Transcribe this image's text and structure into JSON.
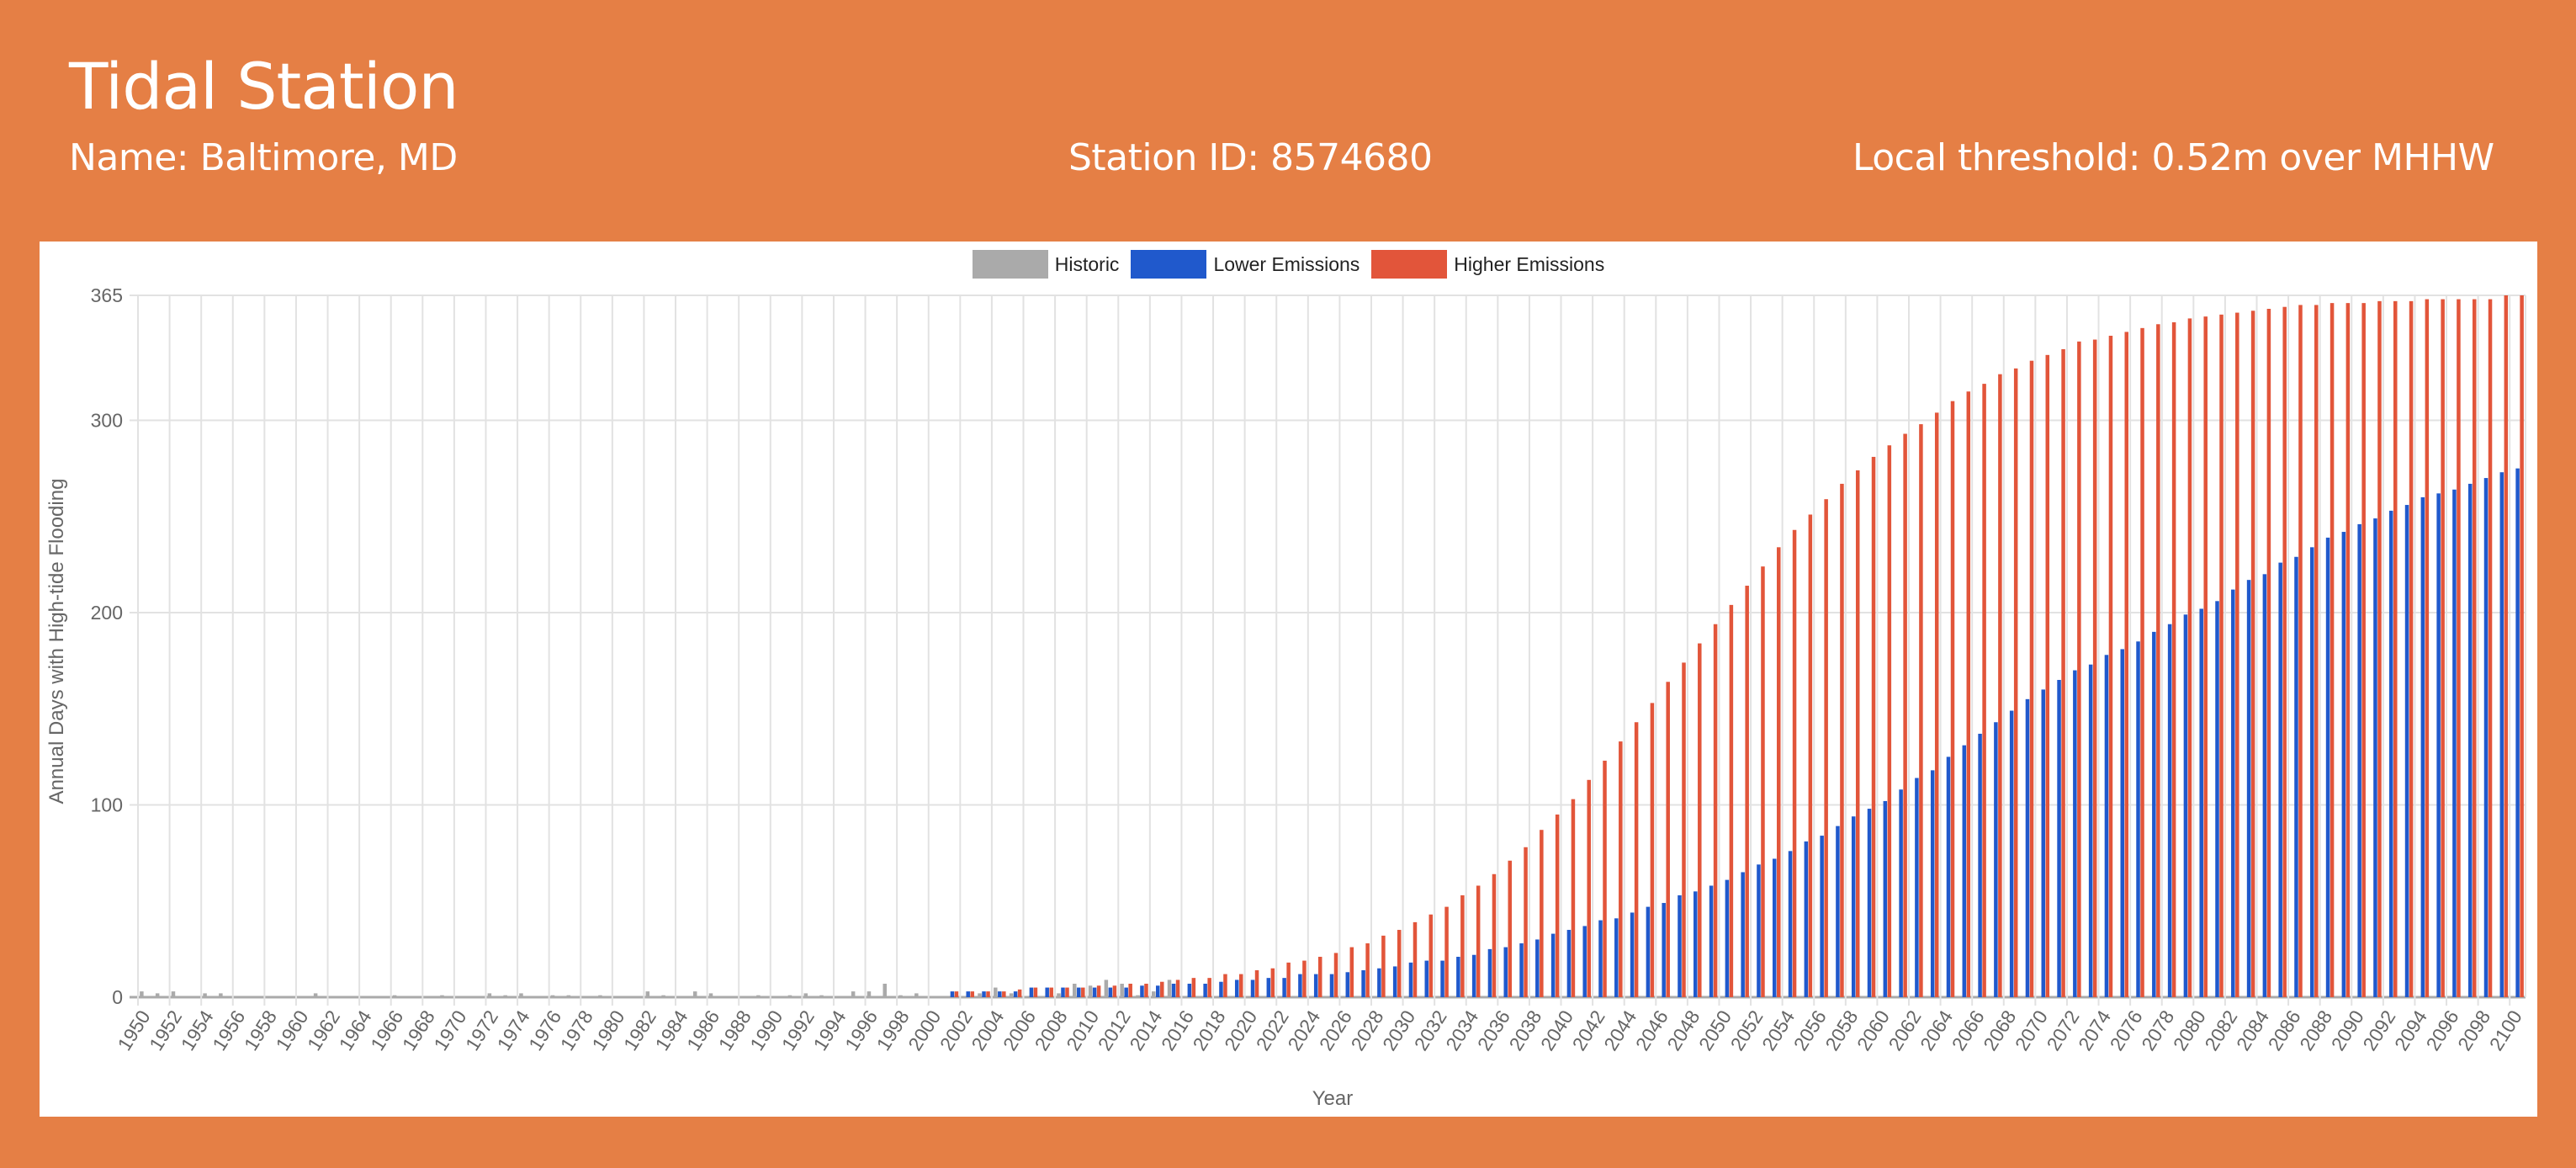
{
  "header": {
    "title": "Tidal Station",
    "name": "Name: Baltimore, MD",
    "station_id": "Station ID: 8574680",
    "threshold": "Local threshold: 0.52m over MHHW"
  },
  "colors": {
    "background": "#E57F45",
    "historic": "#AAAAAA",
    "lower": "#2059CC",
    "higher": "#E2553A"
  },
  "chart_data": {
    "type": "bar",
    "title": "",
    "xlabel": "Year",
    "ylabel": "Annual Days with High-tide Flooding",
    "ylim": [
      0,
      365
    ],
    "yticks": [
      0,
      100,
      200,
      300,
      365
    ],
    "grid": true,
    "legend_position": "top",
    "categories": [
      1950,
      1951,
      1952,
      1953,
      1954,
      1955,
      1956,
      1957,
      1958,
      1959,
      1960,
      1961,
      1962,
      1963,
      1964,
      1965,
      1966,
      1967,
      1968,
      1969,
      1970,
      1971,
      1972,
      1973,
      1974,
      1975,
      1976,
      1977,
      1978,
      1979,
      1980,
      1981,
      1982,
      1983,
      1984,
      1985,
      1986,
      1987,
      1988,
      1989,
      1990,
      1991,
      1992,
      1993,
      1994,
      1995,
      1996,
      1997,
      1998,
      1999,
      2000,
      2001,
      2002,
      2003,
      2004,
      2005,
      2006,
      2007,
      2008,
      2009,
      2010,
      2011,
      2012,
      2013,
      2014,
      2015,
      2016,
      2017,
      2018,
      2019,
      2020,
      2021,
      2022,
      2023,
      2024,
      2025,
      2026,
      2027,
      2028,
      2029,
      2030,
      2031,
      2032,
      2033,
      2034,
      2035,
      2036,
      2037,
      2038,
      2039,
      2040,
      2041,
      2042,
      2043,
      2044,
      2045,
      2046,
      2047,
      2048,
      2049,
      2050,
      2051,
      2052,
      2053,
      2054,
      2055,
      2056,
      2057,
      2058,
      2059,
      2060,
      2061,
      2062,
      2063,
      2064,
      2065,
      2066,
      2067,
      2068,
      2069,
      2070,
      2071,
      2072,
      2073,
      2074,
      2075,
      2076,
      2077,
      2078,
      2079,
      2080,
      2081,
      2082,
      2083,
      2084,
      2085,
      2086,
      2087,
      2088,
      2089,
      2090,
      2091,
      2092,
      2093,
      2094,
      2095,
      2096,
      2097,
      2098,
      2099,
      2100
    ],
    "series": [
      {
        "name": "Historic",
        "color": "#AAAAAA",
        "values": [
          3,
          2,
          3,
          0,
          2,
          2,
          0,
          0,
          0,
          0,
          0,
          2,
          0,
          0,
          0,
          0,
          1,
          0,
          0,
          1,
          0,
          0,
          2,
          1,
          2,
          0,
          1,
          1,
          0,
          1,
          0,
          0,
          3,
          1,
          0,
          3,
          2,
          0,
          0,
          1,
          0,
          1,
          2,
          1,
          0,
          3,
          3,
          7,
          1,
          2,
          0,
          0,
          0,
          2,
          5,
          2,
          0,
          0,
          2,
          7,
          6,
          9,
          7,
          1,
          3,
          9,
          null,
          null,
          null,
          null,
          null,
          null,
          null,
          null,
          null,
          null,
          null,
          null,
          null,
          null,
          null,
          null,
          null,
          null,
          null,
          null,
          null,
          null,
          null,
          null,
          null,
          null,
          null,
          null,
          null,
          null,
          null,
          null,
          null,
          null,
          null,
          null,
          null,
          null,
          null,
          null,
          null,
          null,
          null,
          null,
          null,
          null,
          null,
          null,
          null,
          null,
          null,
          null,
          null,
          null,
          null,
          null,
          null,
          null,
          null,
          null,
          null,
          null,
          null,
          null,
          null,
          null,
          null,
          null,
          null,
          null,
          null,
          null,
          null,
          null,
          null,
          null,
          null,
          null,
          null,
          null,
          null,
          null,
          null,
          null,
          null
        ]
      },
      {
        "name": "Lower Emissions",
        "color": "#2059CC",
        "values": [
          null,
          null,
          null,
          null,
          null,
          null,
          null,
          null,
          null,
          null,
          null,
          null,
          null,
          null,
          null,
          null,
          null,
          null,
          null,
          null,
          null,
          null,
          null,
          null,
          null,
          null,
          null,
          null,
          null,
          null,
          null,
          null,
          null,
          null,
          null,
          null,
          null,
          null,
          null,
          null,
          null,
          null,
          null,
          null,
          null,
          null,
          null,
          null,
          null,
          null,
          null,
          3,
          3,
          3,
          3,
          3,
          5,
          5,
          5,
          5,
          5,
          5,
          5,
          6,
          6,
          7,
          7,
          7,
          8,
          9,
          9,
          10,
          10,
          12,
          12,
          12,
          13,
          14,
          15,
          16,
          18,
          19,
          19,
          21,
          22,
          25,
          26,
          28,
          30,
          33,
          35,
          37,
          40,
          41,
          44,
          47,
          49,
          53,
          55,
          58,
          61,
          65,
          69,
          72,
          76,
          81,
          84,
          89,
          94,
          98,
          102,
          108,
          114,
          118,
          125,
          131,
          137,
          143,
          149,
          155,
          160,
          165,
          170,
          173,
          178,
          181,
          185,
          190,
          194,
          199,
          202,
          206,
          212,
          217,
          220,
          226,
          229,
          234,
          239,
          242,
          246,
          249,
          253,
          256,
          260,
          262,
          264,
          267,
          270,
          273,
          275
        ]
      },
      {
        "name": "Higher Emissions",
        "color": "#E2553A",
        "values": [
          null,
          null,
          null,
          null,
          null,
          null,
          null,
          null,
          null,
          null,
          null,
          null,
          null,
          null,
          null,
          null,
          null,
          null,
          null,
          null,
          null,
          null,
          null,
          null,
          null,
          null,
          null,
          null,
          null,
          null,
          null,
          null,
          null,
          null,
          null,
          null,
          null,
          null,
          null,
          null,
          null,
          null,
          null,
          null,
          null,
          null,
          null,
          null,
          null,
          null,
          null,
          3,
          3,
          3,
          3,
          4,
          5,
          5,
          5,
          5,
          6,
          6,
          7,
          7,
          8,
          9,
          10,
          10,
          12,
          12,
          14,
          15,
          18,
          19,
          21,
          23,
          26,
          28,
          32,
          35,
          39,
          43,
          47,
          53,
          58,
          64,
          71,
          78,
          87,
          95,
          103,
          113,
          123,
          133,
          143,
          153,
          164,
          174,
          184,
          194,
          204,
          214,
          224,
          234,
          243,
          251,
          259,
          267,
          274,
          281,
          287,
          293,
          298,
          304,
          310,
          315,
          319,
          324,
          327,
          331,
          334,
          337,
          341,
          342,
          344,
          346,
          348,
          350,
          351,
          353,
          354,
          355,
          356,
          357,
          358,
          359,
          360,
          360,
          361,
          361,
          361,
          362,
          362,
          362,
          363,
          363,
          363,
          363,
          363,
          365,
          365
        ]
      }
    ]
  }
}
